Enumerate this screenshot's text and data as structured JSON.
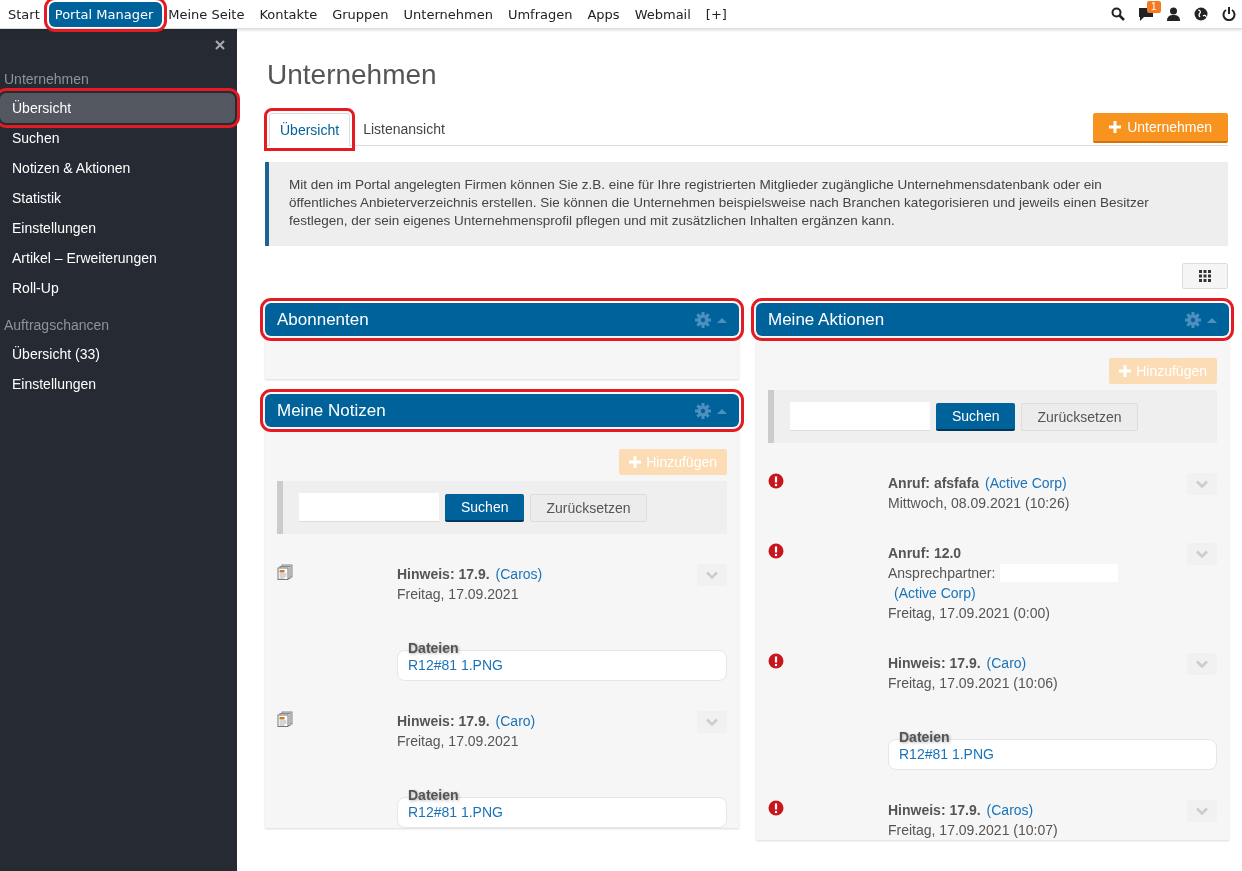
{
  "topnav": {
    "items": [
      {
        "label": "Start",
        "selected": false,
        "highlighted": false
      },
      {
        "label": "Portal Manager",
        "selected": true,
        "highlighted": true
      },
      {
        "label": "Meine Seite",
        "selected": false,
        "highlighted": false
      },
      {
        "label": "Kontakte",
        "selected": false,
        "highlighted": false
      },
      {
        "label": "Gruppen",
        "selected": false,
        "highlighted": false
      },
      {
        "label": "Unternehmen",
        "selected": false,
        "highlighted": false
      },
      {
        "label": "Umfragen",
        "selected": false,
        "highlighted": false
      },
      {
        "label": "Apps",
        "selected": false,
        "highlighted": false
      },
      {
        "label": "Webmail",
        "selected": false,
        "highlighted": false
      },
      {
        "label": "[+]",
        "selected": false,
        "highlighted": false
      }
    ],
    "notification_count": "1"
  },
  "sidebar": {
    "sections": [
      {
        "title": "Unternehmen",
        "items": [
          {
            "label": "Übersicht",
            "selected": true,
            "highlighted": true
          },
          {
            "label": "Suchen",
            "selected": false,
            "highlighted": false
          },
          {
            "label": "Notizen & Aktionen",
            "selected": false,
            "highlighted": false
          },
          {
            "label": "Statistik",
            "selected": false,
            "highlighted": false
          },
          {
            "label": "Einstellungen",
            "selected": false,
            "highlighted": false
          },
          {
            "label": "Artikel – Erweiterungen",
            "selected": false,
            "highlighted": false
          },
          {
            "label": "Roll-Up",
            "selected": false,
            "highlighted": false
          }
        ]
      },
      {
        "title": "Auftragschancen",
        "items": [
          {
            "label": "Übersicht (33)",
            "selected": false,
            "highlighted": false
          },
          {
            "label": "Einstellungen",
            "selected": false,
            "highlighted": false
          }
        ]
      }
    ]
  },
  "page_title": "Unternehmen",
  "tabs": [
    {
      "label": "Übersicht",
      "selected": true,
      "highlighted": true
    },
    {
      "label": "Listenansicht",
      "selected": false,
      "highlighted": false
    }
  ],
  "add_button": "Unternehmen",
  "info": "Mit den im Portal angelegten Firmen können Sie z.B. eine für Ihre registrierten Mitglieder zugängliche Unternehmensdatenbank oder ein öffentliches Anbieterverzeichnis erstellen. Sie können die Unternehmen beispielsweise nach Branchen kategorisieren und jeweils einen Besitzer festlegen, der sein eigenes Unternehmensprofil pflegen und mit zusätzlichen Inhalten ergänzen kann.",
  "columns": [
    [
      {
        "title": "Abonnenten",
        "highlighted": true
      },
      {
        "title": "Meine Notizen",
        "highlighted": true,
        "add": {
          "label": "Hinzufügen",
          "disabled": true
        },
        "search": {
          "button": "Suchen",
          "reset": "Zurücksetzen"
        },
        "entries": [
          {
            "kind": "note",
            "title": "Hinweis: 17.9.",
            "link": "(Caros)",
            "date": "Freitag, 17.09.2021",
            "files": {
              "label": "Dateien",
              "items": [
                "R12#81 1.PNG"
              ]
            }
          },
          {
            "kind": "note",
            "title": "Hinweis: 17.9.",
            "link": "(Caro)",
            "date": "Freitag, 17.09.2021",
            "files": {
              "label": "Dateien",
              "items": [
                "R12#81 1.PNG"
              ]
            }
          }
        ]
      }
    ],
    [
      {
        "title": "Meine Aktionen",
        "highlighted": true,
        "add": {
          "label": "Hinzufügen",
          "disabled": true
        },
        "search": {
          "button": "Suchen",
          "reset": "Zurücksetzen"
        },
        "entries": [
          {
            "kind": "alert",
            "title": "Anruf: afsfafa",
            "link": "(Active Corp)",
            "date": "Mittwoch, 08.09.2021 (10:26)"
          },
          {
            "kind": "alert",
            "title": "Anruf: 12.0",
            "contact": {
              "label": "Ansprechpartner:",
              "redacted": true,
              "link": "(Active Corp)"
            },
            "date": "Freitag, 17.09.2021 (0:00)"
          },
          {
            "kind": "alert",
            "title": "Hinweis: 17.9.",
            "link": "(Caro)",
            "date": "Freitag, 17.09.2021 (10:06)",
            "files": {
              "label": "Dateien",
              "items": [
                "R12#81 1.PNG"
              ]
            }
          },
          {
            "kind": "alert",
            "title": "Hinweis: 17.9.",
            "link": "(Caros)",
            "date": "Freitag, 17.09.2021 (10:07)"
          }
        ]
      }
    ]
  ]
}
